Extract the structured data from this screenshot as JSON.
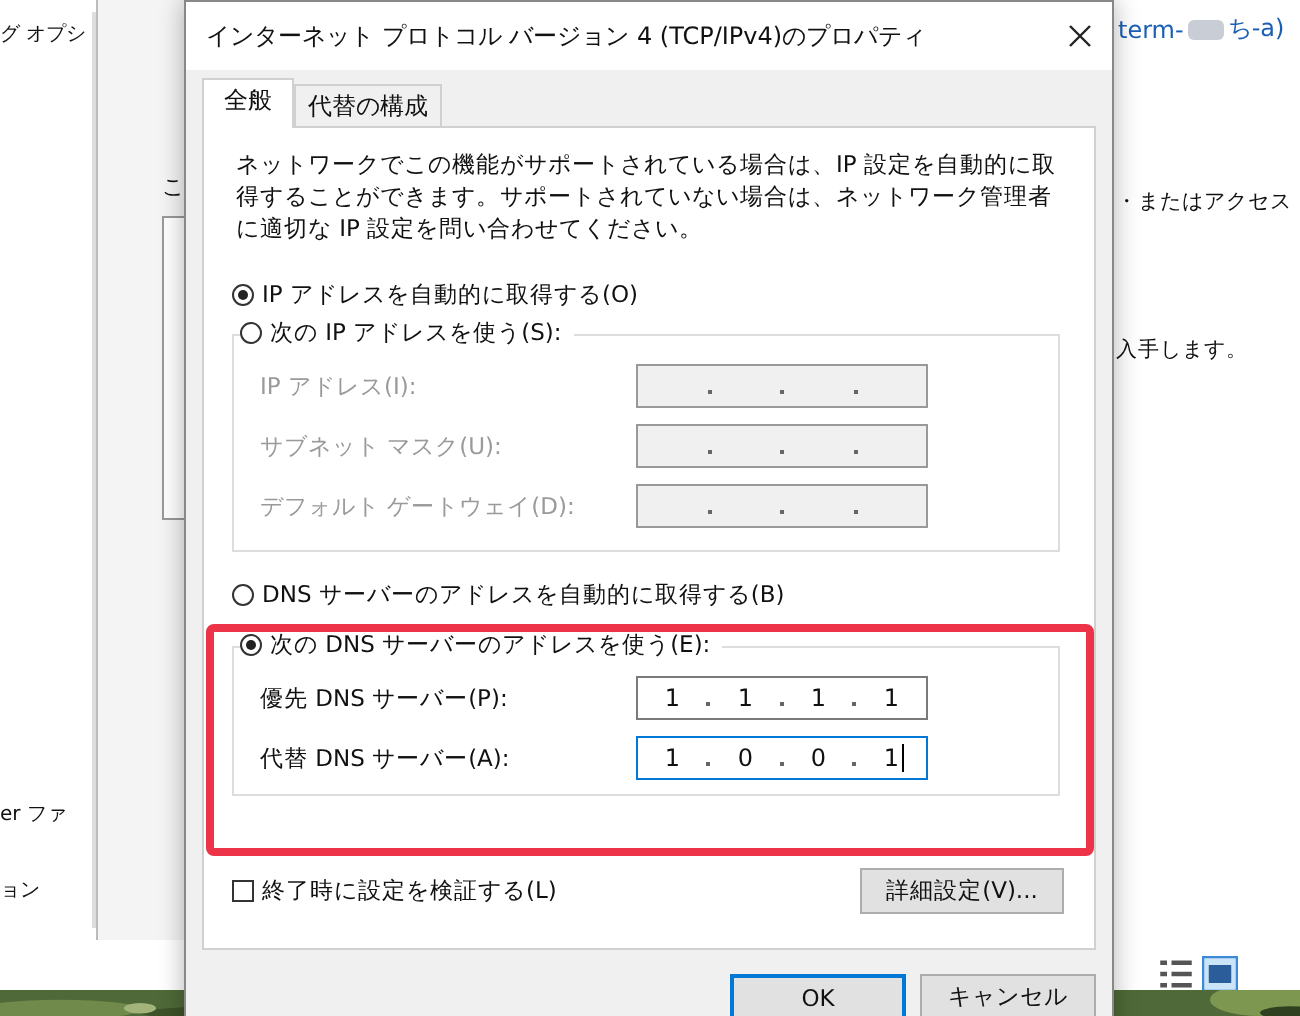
{
  "background": {
    "left_texts": [
      "グ オプシ",
      "er ファ",
      "ョン"
    ],
    "left_window_texts": [
      "こ"
    ],
    "link_start": "term-",
    "link_end": "ち-a)",
    "right_texts": [
      "・またはアクセス",
      "入手します。"
    ]
  },
  "dialog": {
    "title": "インターネット プロトコル バージョン 4 (TCP/IPv4)のプロパティ",
    "tabs": [
      {
        "label": "全般",
        "selected": true
      },
      {
        "label": "代替の構成",
        "selected": false
      }
    ],
    "description": "ネットワークでこの機能がサポートされている場合は、IP 設定を自動的に取得することができます。サポートされていない場合は、ネットワーク管理者に適切な IP 設定を問い合わせてください。",
    "ip_options": [
      {
        "label": "IP アドレスを自動的に取得する(O)",
        "selected": true
      },
      {
        "label": "次の IP アドレスを使う(S):",
        "selected": false
      }
    ],
    "ip_fields": [
      {
        "label": "IP アドレス(I):",
        "disabled": true
      },
      {
        "label": "サブネット マスク(U):",
        "disabled": true
      },
      {
        "label": "デフォルト ゲートウェイ(D):",
        "disabled": true
      }
    ],
    "dns_options": [
      {
        "label": "DNS サーバーのアドレスを自動的に取得する(B)",
        "selected": false
      },
      {
        "label": "次の DNS サーバーのアドレスを使う(E):",
        "selected": true
      }
    ],
    "dns_fields": [
      {
        "label": "優先 DNS サーバー(P):",
        "disabled": false,
        "octets": [
          "1",
          "1",
          "1",
          "1"
        ],
        "focused": false
      },
      {
        "label": "代替 DNS サーバー(A):",
        "disabled": false,
        "octets": [
          "1",
          "0",
          "0",
          "1"
        ],
        "focused": true
      }
    ],
    "validate": {
      "label": "終了時に設定を検証する(L)",
      "checked": false
    },
    "advanced_button": "詳細設定(V)...",
    "buttons": [
      {
        "label": "OK",
        "default": true
      },
      {
        "label": "キャンセル",
        "default": false
      }
    ]
  }
}
